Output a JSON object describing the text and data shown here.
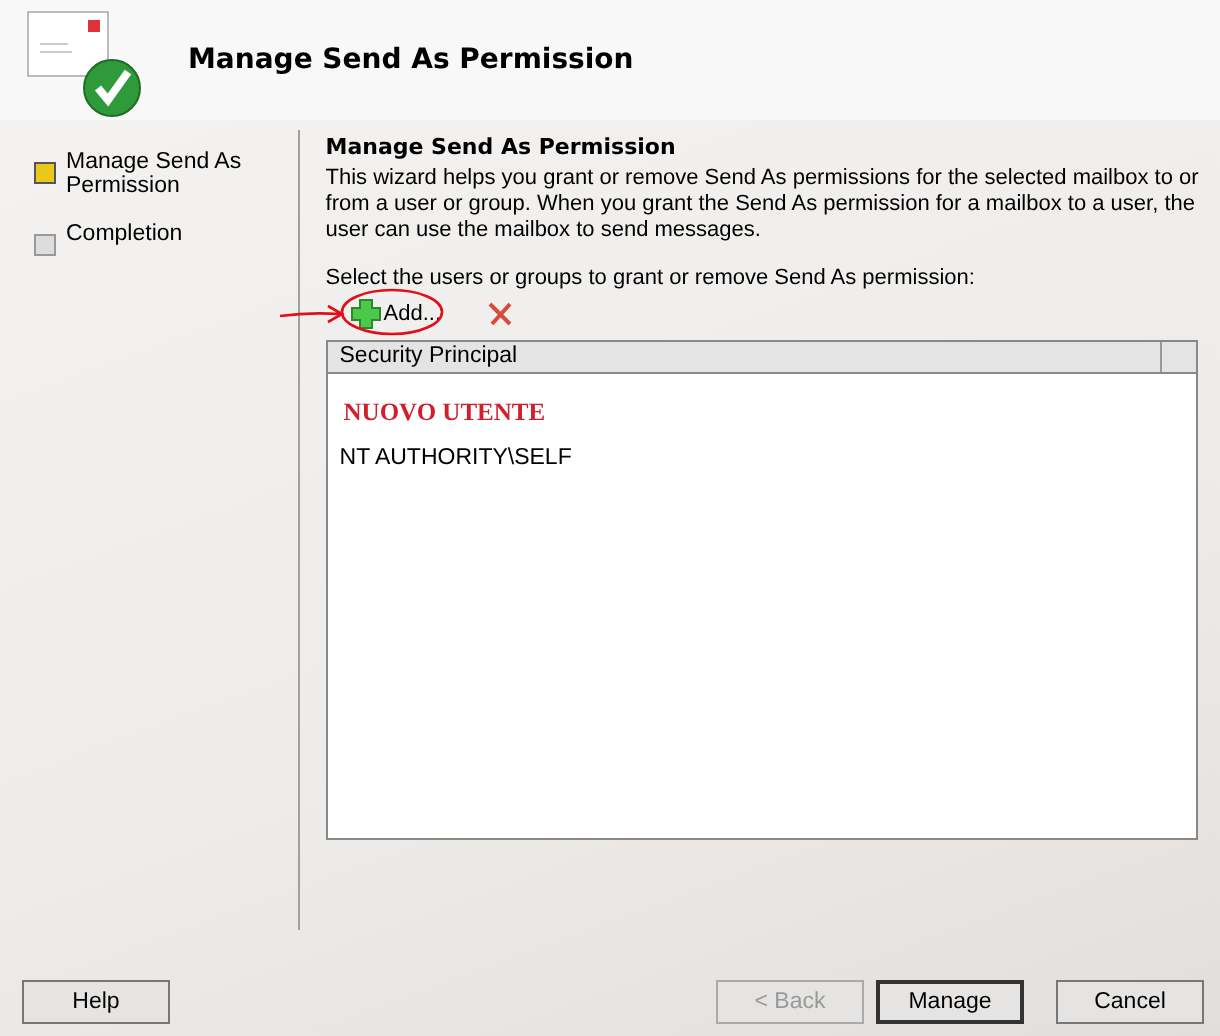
{
  "window": {
    "title": "Manage Send As Permission"
  },
  "steps": [
    {
      "label": "Manage Send As Permission",
      "selected": true
    },
    {
      "label": "Completion",
      "selected": false
    }
  ],
  "page": {
    "heading": "Manage Send As Permission",
    "description": "This wizard helps you grant or remove Send As permissions for the selected mailbox to or from a user or group. When you grant the Send As permission for a mailbox to a user, the user can use the mailbox to send messages.",
    "prompt": "Select the users or groups to grant or remove Send As permission:"
  },
  "toolbar": {
    "add_label": "Add..."
  },
  "table": {
    "columns": [
      "Security Principal"
    ],
    "rows": [
      {
        "kind": "annotation",
        "text": "NUOVO UTENTE"
      },
      {
        "kind": "entry",
        "text": "NT AUTHORITY\\SELF"
      }
    ]
  },
  "help_button": {
    "label": "Help"
  },
  "buttons": [
    {
      "label": "< Back",
      "disabled": true,
      "default": false
    },
    {
      "label": "Manage",
      "disabled": false,
      "default": true
    },
    {
      "label": "Cancel",
      "disabled": false,
      "default": false
    }
  ]
}
